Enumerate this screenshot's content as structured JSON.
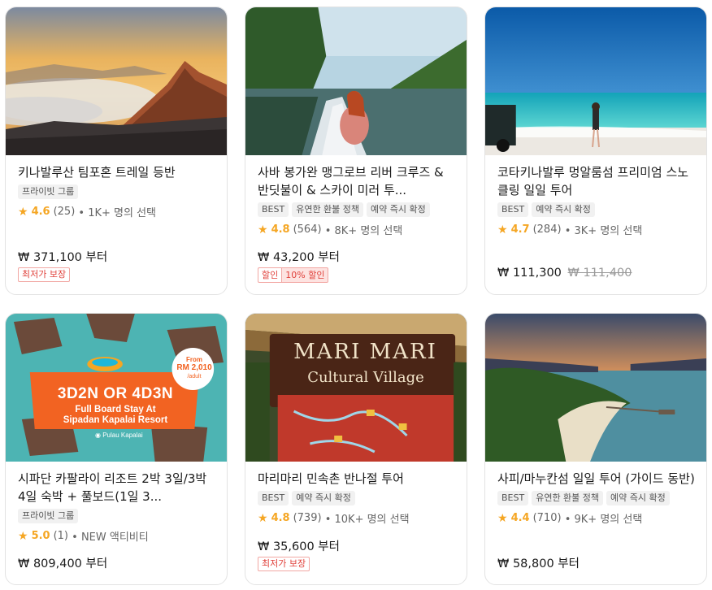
{
  "cards": [
    {
      "title": "키나발루산 팀포혼 트레일 등반",
      "tags": [
        "프라이빗 그룹"
      ],
      "score": "4.6",
      "reviews": "(25)",
      "booked": "• 1K+ 명의 선택",
      "price": "₩ 371,100 부터",
      "badge": "최저가 보장"
    },
    {
      "title": "사바 봉가완 맹그로브 리버 크루즈 & 반딧불이 & 스카이 미러 투...",
      "tags": [
        "BEST",
        "유연한 환불 정책",
        "예약 즉시 확정"
      ],
      "score": "4.8",
      "reviews": "(564)",
      "booked": "• 8K+ 명의 선택",
      "price": "₩ 43,200 부터",
      "discount_label": "할인",
      "discount_value": "10% 할인"
    },
    {
      "title": "코타키나발루 멍알룸섬 프리미엄 스노클링 일일 투어",
      "tags": [
        "BEST",
        "예약 즉시 확정"
      ],
      "score": "4.7",
      "reviews": "(284)",
      "booked": "• 3K+ 명의 선택",
      "price": "₩ 111,300",
      "old_price": "₩ 111,400"
    },
    {
      "title": "시파단 카팔라이 리조트 2박 3일/3박 4일 숙박 + 풀보드(1일 3...",
      "tags": [
        "프라이빗 그룹"
      ],
      "score": "5.0",
      "reviews": "(1)",
      "booked": "• NEW 액티비티",
      "price": "₩ 809,400 부터",
      "image_text": {
        "headline": "3D2N OR 4D3N",
        "sub1": "Full Board Stay At",
        "sub2": "Sipadan Kapalai Resort",
        "from": "From",
        "amount": "RM 2,010",
        "per": "/adult",
        "location": "Pulau Kapalai"
      }
    },
    {
      "title": "마리마리 민속촌 반나절 투어",
      "tags": [
        "BEST",
        "예약 즉시 확정"
      ],
      "score": "4.8",
      "reviews": "(739)",
      "booked": "• 10K+ 명의 선택",
      "price": "₩ 35,600 부터",
      "badge": "최저가 보장",
      "image_text": {
        "sign1": "MARI MARI",
        "sign2": "Cultural Village"
      }
    },
    {
      "title": "사피/마누칸섬 일일 투어 (가이드 동반)",
      "tags": [
        "BEST",
        "유연한 환불 정책",
        "예약 즉시 확정"
      ],
      "score": "4.4",
      "reviews": "(710)",
      "booked": "• 9K+ 명의 선택",
      "price": "₩ 58,800 부터"
    }
  ],
  "colors": {
    "star": "#f5a623",
    "badge_red": "#e0413b",
    "kapalai_orange": "#f26322"
  }
}
